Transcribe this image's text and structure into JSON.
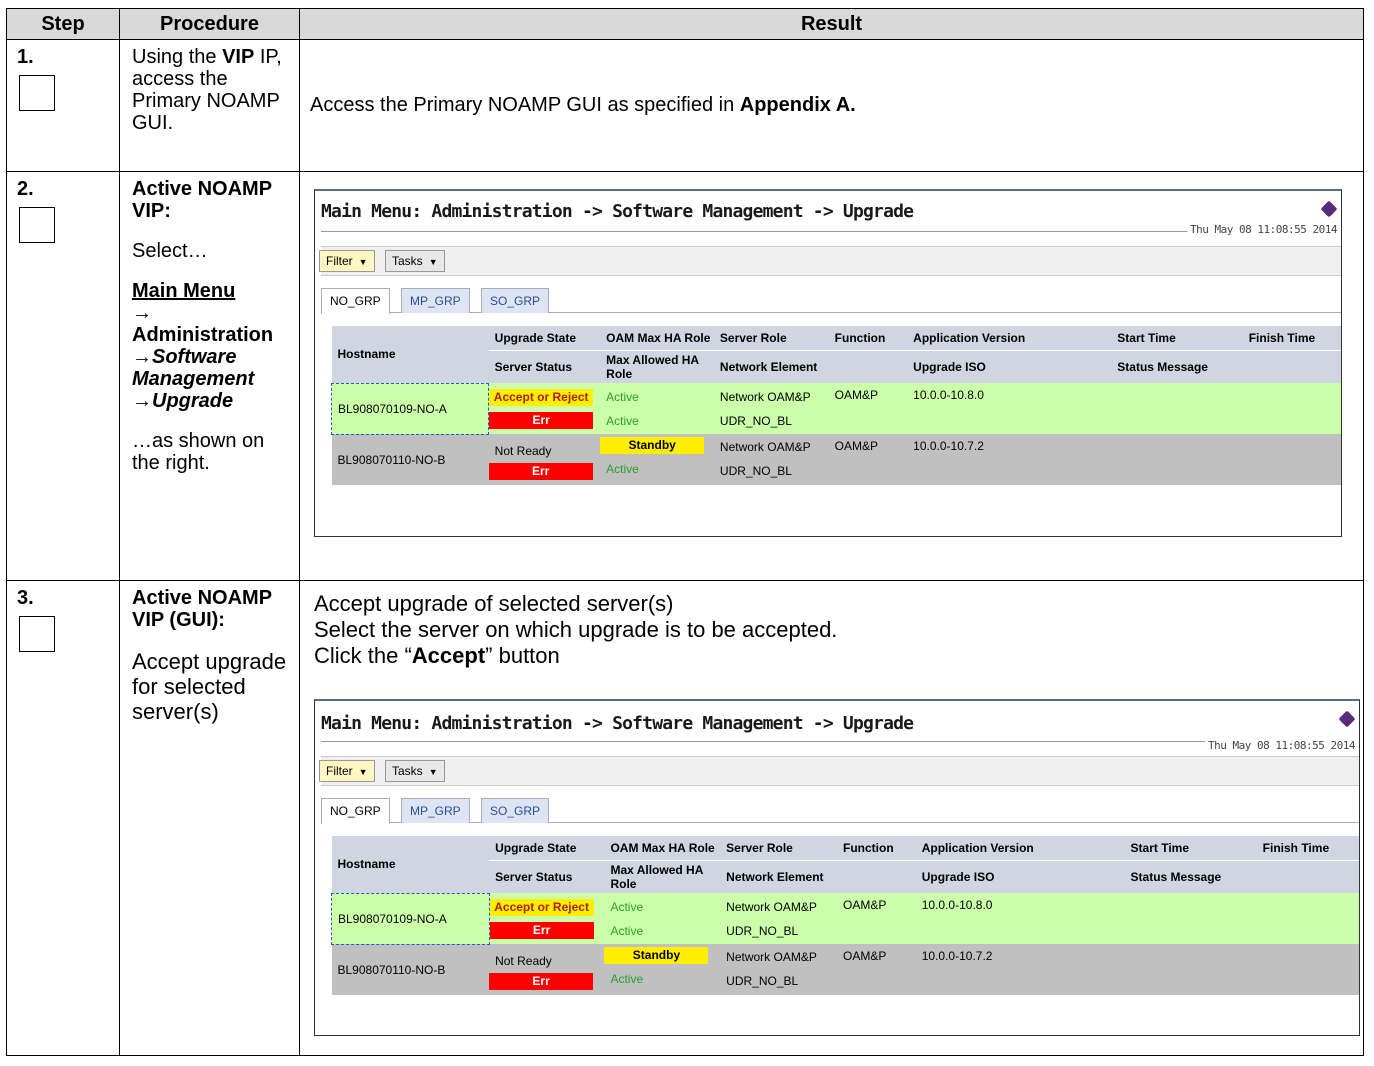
{
  "header": {
    "step": "Step",
    "procedure": "Procedure",
    "result": "Result"
  },
  "steps": [
    {
      "number": "1.",
      "procedure": {
        "t1": "Using the ",
        "b1": "VIP",
        "t2": " IP, access the Primary NOAMP GUI."
      },
      "result": {
        "t1": "Access the Primary NOAMP GUI as specified in ",
        "b1": "Appendix A."
      }
    },
    {
      "number": "2.",
      "procedure": {
        "title": "Active NOAMP VIP:",
        "select": "Select…",
        "menu": "Main Menu",
        "arrow1": "→",
        "admin": "Administration",
        "sw": "→Software Management",
        "up": "→Upgrade",
        "shown": "…as shown on the right."
      }
    },
    {
      "number": "3.",
      "procedure": {
        "title": "Active NOAMP VIP (GUI):",
        "desc": "Accept upgrade for selected server(s)"
      },
      "result": {
        "line1": "Accept upgrade of selected server(s)",
        "line2": "Select the server on which upgrade is to be accepted.",
        "line3a": "Click the “",
        "line3b": "Accept",
        "line3c": "” button"
      }
    }
  ],
  "gui": {
    "title": "Main Menu: Administration -> Software Management -> Upgrade",
    "datetime": "Thu May 08 11:08:55 2014",
    "help_icon": "help-book-icon",
    "filter": "Filter",
    "tasks": "Tasks",
    "tabs": [
      "NO_GRP",
      "MP_GRP",
      "SO_GRP"
    ],
    "active_tab": "NO_GRP",
    "columns": {
      "hostname": "Hostname",
      "upgrade_state": "Upgrade State",
      "server_status": "Server Status",
      "oam_max_ha_role": "OAM Max HA Role",
      "max_allowed_ha_role": "Max Allowed HA Role",
      "server_role": "Server Role",
      "network_element": "Network Element",
      "function": "Function",
      "application_version": "Application Version",
      "upgrade_iso": "Upgrade ISO",
      "start_time": "Start Time",
      "status_message": "Status Message",
      "finish_time": "Finish Time"
    },
    "rows": [
      {
        "hostname": "BL908070109-NO-A",
        "upgrade_state": "Accept or Reject",
        "server_status": "Err",
        "oam_max_ha_role": "Active",
        "max_allowed_ha_role": "Active",
        "server_role": "Network OAM&P",
        "network_element": "UDR_NO_BL",
        "function": "OAM&P",
        "application_version": "10.0.0-10.8.0",
        "colors": {
          "row": "#ccffaa",
          "state": "#ffee00",
          "status": "#ff0000"
        }
      },
      {
        "hostname": "BL908070110-NO-B",
        "upgrade_state": "Not Ready",
        "server_status": "Err",
        "oam_max_ha_role": "Standby",
        "max_allowed_ha_role": "Active",
        "server_role": "Network OAM&P",
        "network_element": "UDR_NO_BL",
        "function": "OAM&P",
        "application_version": "10.0.0-10.7.2",
        "colors": {
          "row": "#c0c0c0",
          "role": "#ffee00",
          "status": "#ff0000"
        }
      }
    ]
  }
}
